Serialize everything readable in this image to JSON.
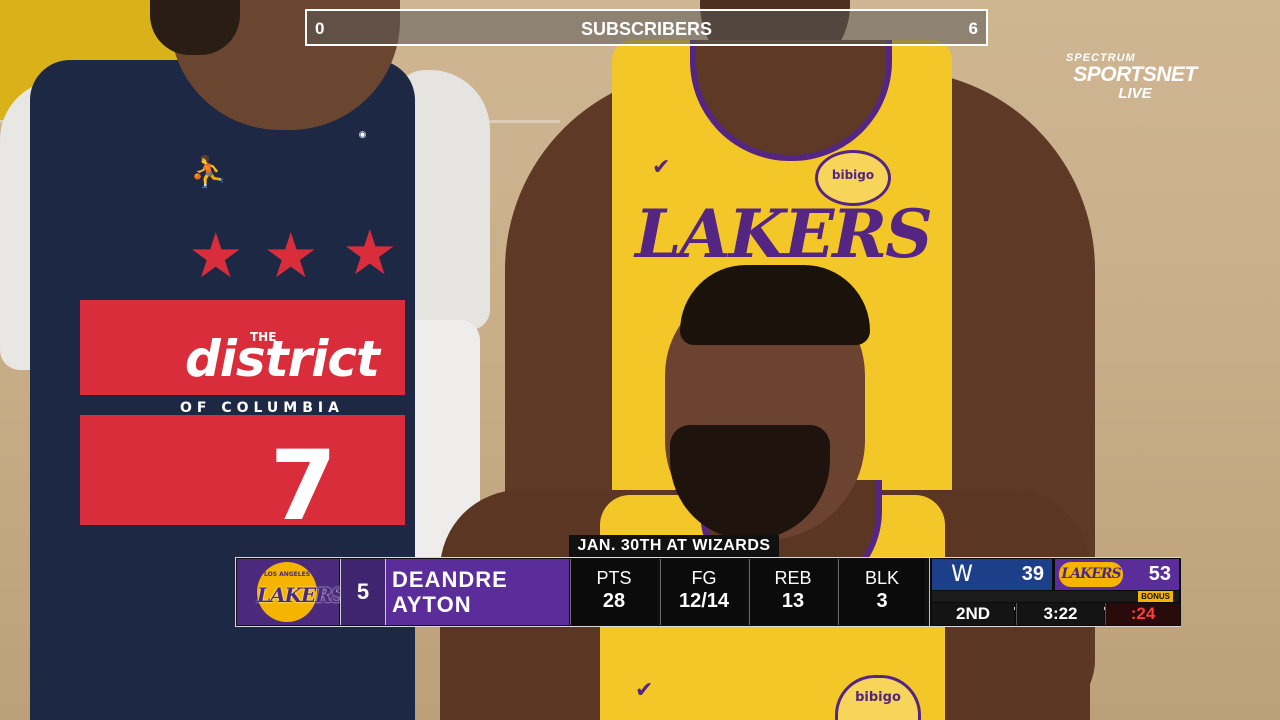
{
  "overlay": {
    "subscriber_counter": {
      "left_value": "0",
      "title": "SUBSCRIBERS",
      "right_value": "6"
    },
    "network": {
      "line1": "SPECTRUM",
      "line2": "SPORTSNET",
      "line3": "LIVE"
    }
  },
  "scene": {
    "left_jersey_number": "7",
    "left_jersey_word": "district",
    "left_jersey_the": "THE",
    "left_jersey_sub": "OF COLUMBIA",
    "back_jersey_word": "LAKERS",
    "sponsor": "bibigo"
  },
  "lower_third": {
    "context": "JAN. 30TH AT WIZARDS",
    "team_logo_text": "LAKERS",
    "team_logo_small": "LOS ANGELES",
    "player_number": "5",
    "player_first": "DEANDRE",
    "player_last": "AYTON",
    "stats": [
      {
        "label": "PTS",
        "value": "28"
      },
      {
        "label": "FG",
        "value": "12/14"
      },
      {
        "label": "REB",
        "value": "13"
      },
      {
        "label": "BLK",
        "value": "3"
      }
    ]
  },
  "scoreboard": {
    "home_score": "39",
    "away_logo_text": "LAKERS",
    "away_score": "53",
    "bonus": "BONUS",
    "quarter": "2ND",
    "game_clock": "3:22",
    "shot_clock": ":24"
  },
  "colors": {
    "lakers_purple": "#5a2d9a",
    "lakers_gold": "#f5b400",
    "wizards_blue": "#1d3f8a",
    "wizards_red": "#d92d3c"
  }
}
